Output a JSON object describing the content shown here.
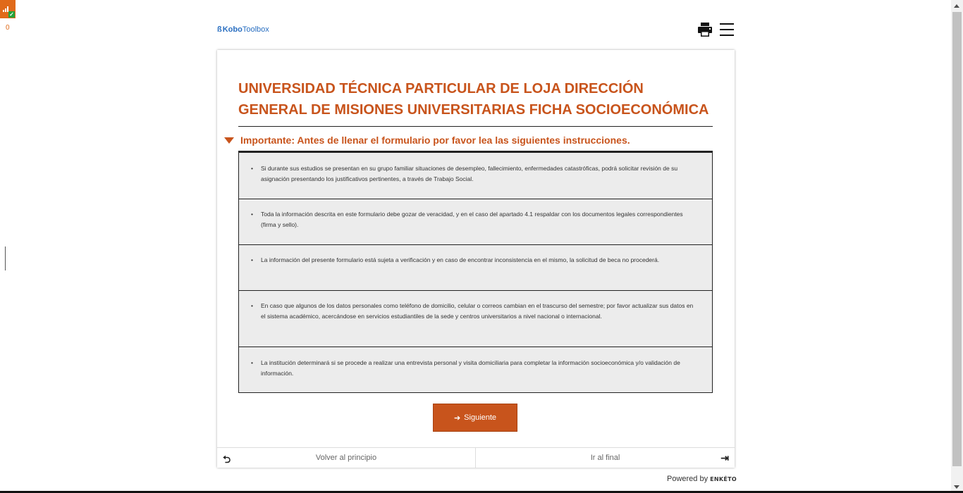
{
  "queue": {
    "count": "0",
    "icon": "queue-status-icon",
    "color": "#e06a1a"
  },
  "header": {
    "logo_prefix": "Kobo",
    "logo_suffix": "Toolbox",
    "print_icon": "print-icon",
    "menu_icon": "hamburger-menu-icon"
  },
  "form": {
    "title": "UNIVERSIDAD TÉCNICA PARTICULAR DE LOJA DIRECCIÓN GENERAL DE MISIONES UNIVERSITARIAS FICHA SOCIOECONÓMICA",
    "group": {
      "label": "Importante: Antes de llenar el formulario por favor lea las siguientes instrucciones.",
      "expanded": true,
      "notes": [
        "Si durante sus estudios se presentan en su grupo familiar situaciones de desempleo, fallecimiento, enfermedades catastróficas, podrá solicitar revisión de su asignación presentando los justificativos pertinentes, a través de Trabajo Social.",
        "Toda la información descrita en este formulario debe gozar de veracidad, y en el caso del apartado 4.1 respaldar con los documentos legales correspondientes (firma y sello).",
        "La información del presente formulario está sujeta a verificación y en caso de encontrar inconsistencia en el mismo, la solicitud de beca no procederá.",
        "En caso que algunos de los datos personales como teléfono de domicilio, celular o correos cambian en el trascurso del semestre; por favor actualizar sus datos en el sistema académico, acercándose en servicios estudiantiles de la sede y centros universitarios a nivel nacional o internacional.",
        "La institución determinará si se procede a realizar una entrevista personal y visita domiciliaria para completar la información socioeconómica y/o validación de información."
      ]
    },
    "next_button": "Siguiente",
    "accent_color": "#c8541c"
  },
  "navigation": {
    "back_to_start": "Volver al principio",
    "go_to_end": "Ir al final"
  },
  "footer": {
    "powered_prefix": "Powered by",
    "powered_brand": "ENKÉTO"
  }
}
